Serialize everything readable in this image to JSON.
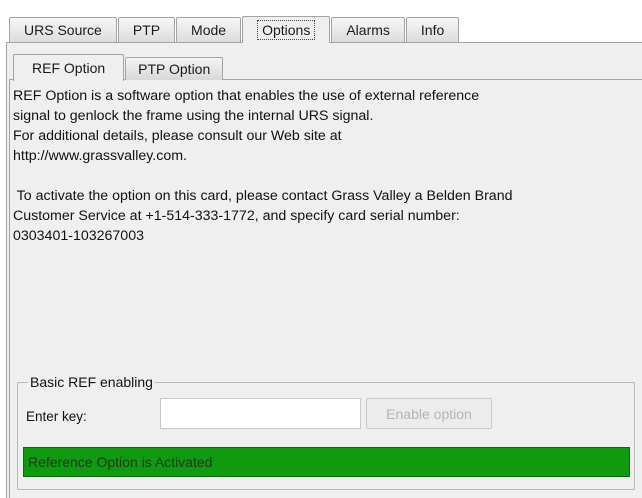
{
  "main_tabs": [
    {
      "label": "URS Source",
      "active": false
    },
    {
      "label": "PTP",
      "active": false
    },
    {
      "label": "Mode",
      "active": false
    },
    {
      "label": "Options",
      "active": true
    },
    {
      "label": "Alarms",
      "active": false
    },
    {
      "label": "Info",
      "active": false
    }
  ],
  "sub_tabs": [
    {
      "label": "REF Option",
      "active": true
    },
    {
      "label": "PTP Option",
      "active": false
    }
  ],
  "description": {
    "line1": "REF Option is a software option that enables the use of external reference",
    "line2": "signal to genlock the frame using the internal URS signal.",
    "line3": "For additional details, please consult our Web site at",
    "line4": "http://www.grassvalley.com.",
    "line5": " To activate the option on this card, please contact Grass Valley a Belden Brand",
    "line6": "Customer Service at +1-514-333-1772, and specify card serial number:",
    "line7": "0303401-103267003"
  },
  "enabling": {
    "group_title": "Basic REF enabling",
    "key_label": "Enter key:",
    "key_value": "",
    "enable_button": "Enable option",
    "enable_button_disabled": true,
    "status_text": "Reference Option is Activated",
    "status_color": "#0f9a0f"
  }
}
